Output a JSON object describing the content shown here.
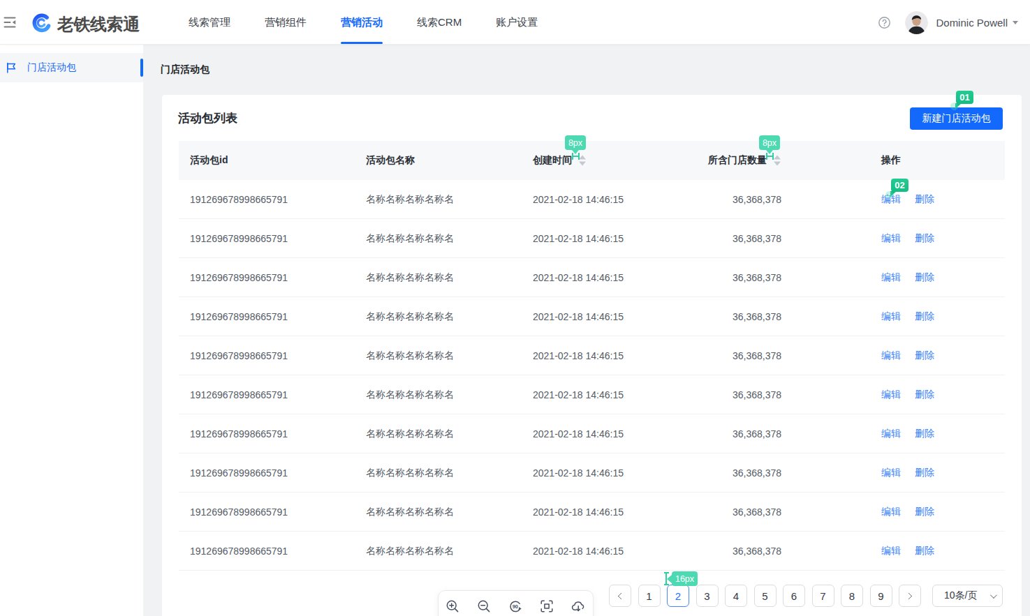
{
  "app": {
    "logo_text": "老铁线索通",
    "collapse_icon": "menu-fold-icon"
  },
  "topnav": {
    "items": [
      {
        "label": "线索管理",
        "active": false
      },
      {
        "label": "营销组件",
        "active": false
      },
      {
        "label": "营销活动",
        "active": true
      },
      {
        "label": "线索CRM",
        "active": false
      },
      {
        "label": "账户设置",
        "active": false
      }
    ]
  },
  "user": {
    "name": "Dominic Powell"
  },
  "help_icon": "question-circle-icon",
  "sidebar": {
    "items": [
      {
        "label": "门店活动包",
        "icon": "flag-icon",
        "active": true
      }
    ]
  },
  "breadcrumb": "门店活动包",
  "panel": {
    "title": "活动包列表",
    "new_button_label": "新建门店活动包"
  },
  "table": {
    "columns": [
      {
        "label": "活动包id",
        "sortable": false
      },
      {
        "label": "活动包名称",
        "sortable": false
      },
      {
        "label": "创建时间",
        "sortable": true
      },
      {
        "label": "所含门店数量",
        "sortable": true
      },
      {
        "label": "操作",
        "sortable": false
      }
    ],
    "edit_label": "编辑",
    "delete_label": "删除",
    "rows": [
      {
        "id": "191269678998665791",
        "name": "名称名称名称名称名",
        "created": "2021-02-18 14:46:15",
        "stores": "36,368,378"
      },
      {
        "id": "191269678998665791",
        "name": "名称名称名称名称名",
        "created": "2021-02-18 14:46:15",
        "stores": "36,368,378"
      },
      {
        "id": "191269678998665791",
        "name": "名称名称名称名称名",
        "created": "2021-02-18 14:46:15",
        "stores": "36,368,378"
      },
      {
        "id": "191269678998665791",
        "name": "名称名称名称名称名",
        "created": "2021-02-18 14:46:15",
        "stores": "36,368,378"
      },
      {
        "id": "191269678998665791",
        "name": "名称名称名称名称名",
        "created": "2021-02-18 14:46:15",
        "stores": "36,368,378"
      },
      {
        "id": "191269678998665791",
        "name": "名称名称名称名称名",
        "created": "2021-02-18 14:46:15",
        "stores": "36,368,378"
      },
      {
        "id": "191269678998665791",
        "name": "名称名称名称名称名",
        "created": "2021-02-18 14:46:15",
        "stores": "36,368,378"
      },
      {
        "id": "191269678998665791",
        "name": "名称名称名称名称名",
        "created": "2021-02-18 14:46:15",
        "stores": "36,368,378"
      },
      {
        "id": "191269678998665791",
        "name": "名称名称名称名称名",
        "created": "2021-02-18 14:46:15",
        "stores": "36,368,378"
      },
      {
        "id": "191269678998665791",
        "name": "名称名称名称名称名",
        "created": "2021-02-18 14:46:15",
        "stores": "36,368,378"
      }
    ]
  },
  "pagination": {
    "pages": [
      "1",
      "2",
      "3",
      "4",
      "5",
      "6",
      "7",
      "8",
      "9"
    ],
    "active_page": "2",
    "page_size_label": "10条/页"
  },
  "viewer_toolbar": {
    "icons": [
      "zoom-in",
      "zoom-out",
      "rotate-90",
      "fit-screen",
      "cloud-download"
    ]
  },
  "annotations": {
    "badge_color": "#4dd9b2",
    "number_badge_color": "#1cc48c",
    "items": [
      {
        "text": "01"
      },
      {
        "text": "02"
      },
      {
        "text": "8px"
      },
      {
        "text": "8px"
      },
      {
        "text": "16px"
      }
    ]
  },
  "colors": {
    "primary_blue": "#1269fb",
    "link_blue": "#3380ff",
    "page_bg": "#f1f2f4",
    "table_header_bg": "#f7f8fa"
  }
}
